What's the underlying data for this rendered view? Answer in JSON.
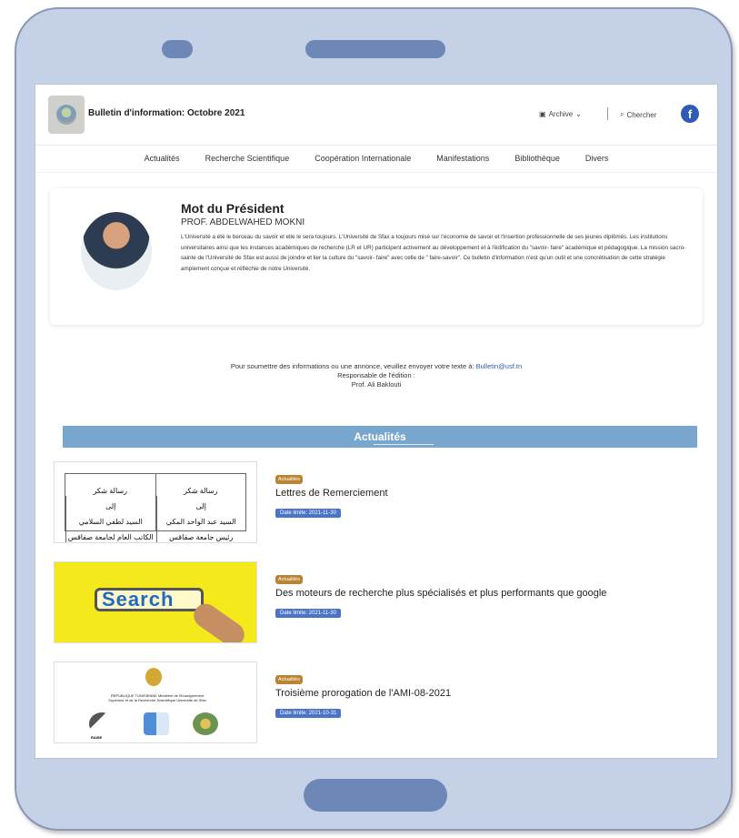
{
  "header": {
    "site_title": "Bulletin d'information: Octobre 2021",
    "archive_label": "Archive",
    "search_label": "Chercher",
    "social_label": "f"
  },
  "nav": {
    "items": [
      "Actualités",
      "Recherche Scientifique",
      "Coopération Internationale",
      "Manifestations",
      "Bibliothèque",
      "Divers"
    ]
  },
  "president": {
    "title": "Mot du Président",
    "name": "PROF. ABDELWAHED MOKNI",
    "text": "L'Université a été le berceau du savoir et elle le sera toujours. L'Université de Sfax a toujours misé sur l'économie de savoir et l'insertion professionnelle de ses jeunes diplômés. Les institutions universitaires ainsi que les instances académiques de recherche (LR et UR) participent activement au développement et à l'édification du \"savoir- faire\" académique et pédagogique. La mission sacro-sainte de l'Université de Sfax est aussi de joindre et lier la culture du \"savoir- faire\" avec celle de \" faire-savoir\". Ce bulletin d'information n'est qu'un outil et une concrétisation de cette stratégie amplement conçue et réfléchie de notre Université."
  },
  "submit": {
    "line1": "Pour soumettre des informations ou une annonce, veuillez envoyer votre texte à:",
    "email": "Bulletin@usf.tn",
    "line2": "Responsable de l'édition :",
    "line3": "Prof. Ali Baklouti"
  },
  "section": {
    "title": "Actualités"
  },
  "news": [
    {
      "category": "Actualités",
      "title": "Lettres de Remerciement",
      "date": "Date limite: 2021-11-30"
    },
    {
      "category": "Actualités",
      "title": "Des moteurs de recherche plus spécialisés et plus performants que google",
      "date": "Date limite: 2021-11-30"
    },
    {
      "category": "Actualités",
      "title": "Troisième prorogation de l'AMI-08-2021",
      "date": "Date limite: 2021-10-31"
    }
  ],
  "thumbs": {
    "search_word": "Search",
    "letters_left": [
      "رسالة شكر",
      "إلى",
      "السيد لطفي السلامي",
      "الكاتب العام لجامعة صفاقس"
    ],
    "letters_right": [
      "رسالة شكر",
      "إلى",
      "السيد عبد الواحد المكي",
      "رئيس جامعة صفاقس"
    ],
    "inst_header": "REPUBLIQUE TUNISIENNE Ministère de l'Enseignement Supérieur et de la Recherche Scientifique Université de Sfax",
    "inst_logo_label": "RAISE"
  }
}
